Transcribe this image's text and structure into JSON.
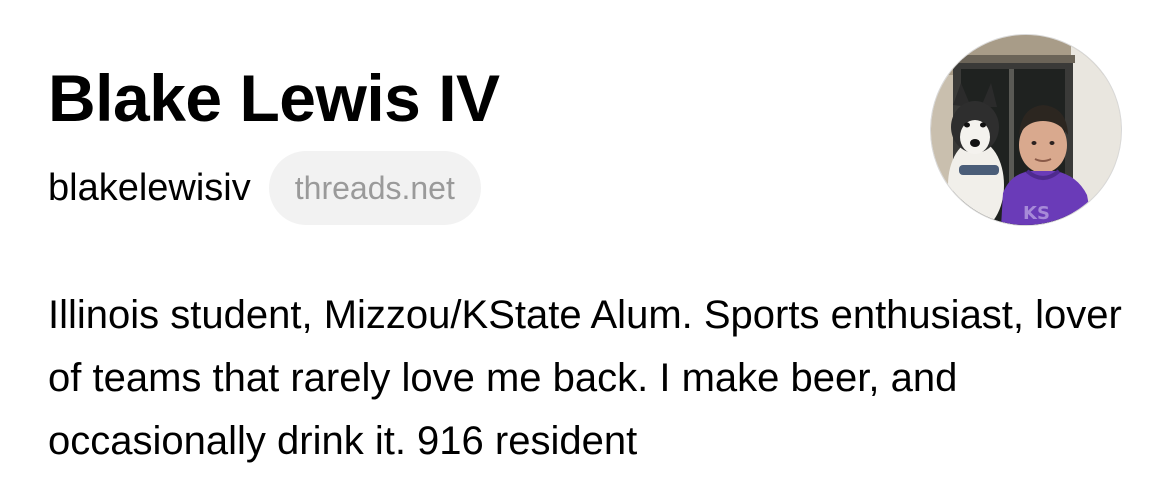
{
  "profile": {
    "display_name": "Blake Lewis IV",
    "username": "blakelewisiv",
    "domain_badge": "threads.net",
    "bio": "Illinois student, Mizzou/KState Alum. Sports enthusiast, lover of teams that rarely love me back. I make beer, and occasionally drink it. 916 resident",
    "avatar_icon": "profile-photo",
    "colors": {
      "text": "#000000",
      "badge_background": "#f2f2f2",
      "badge_text": "#9a9a9a",
      "avatar_hoodie": "#6a3bb8"
    }
  }
}
